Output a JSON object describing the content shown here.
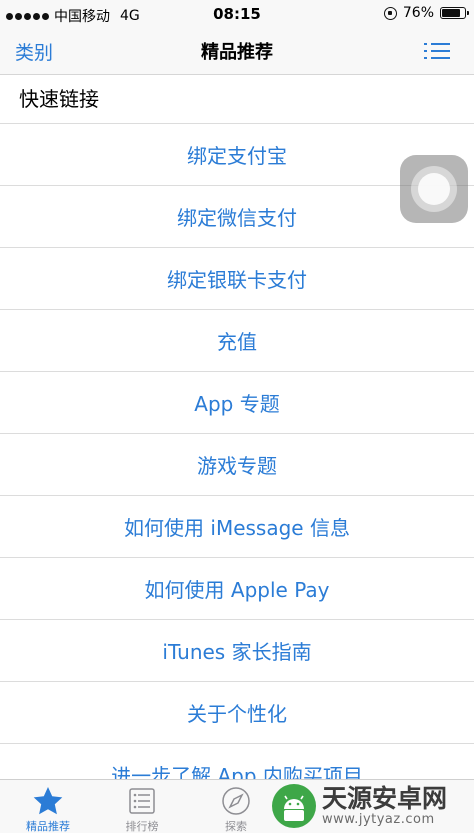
{
  "status_bar": {
    "carrier": "中国移动",
    "network": "4G",
    "time": "08:15",
    "battery": "76%",
    "battery_level": 0.76
  },
  "nav": {
    "left": "类别",
    "title": "精品推荐",
    "right_icon": "list-icon"
  },
  "section": {
    "title": "快速链接"
  },
  "links": [
    "绑定支付宝",
    "绑定微信支付",
    "绑定银联卡支付",
    "充值",
    "App 专题",
    "游戏专题",
    "如何使用 iMessage 信息",
    "如何使用 Apple Pay",
    "iTunes 家长指南",
    "关于个性化",
    "进一步了解 App 内购买项目"
  ],
  "tabs": [
    {
      "label": "精品推荐",
      "icon": "star-icon",
      "active": true
    },
    {
      "label": "排行榜",
      "icon": "ranking-list-icon",
      "active": false
    },
    {
      "label": "探索",
      "icon": "compass-icon",
      "active": false
    }
  ],
  "watermark": {
    "name": "天源安卓网",
    "url": "www.jytyaz.com"
  },
  "colors": {
    "accent": "#2b7cd6",
    "separator": "#dcdcdc",
    "bar_bg": "#f8f8f8",
    "watermark_green": "#3ea748"
  }
}
